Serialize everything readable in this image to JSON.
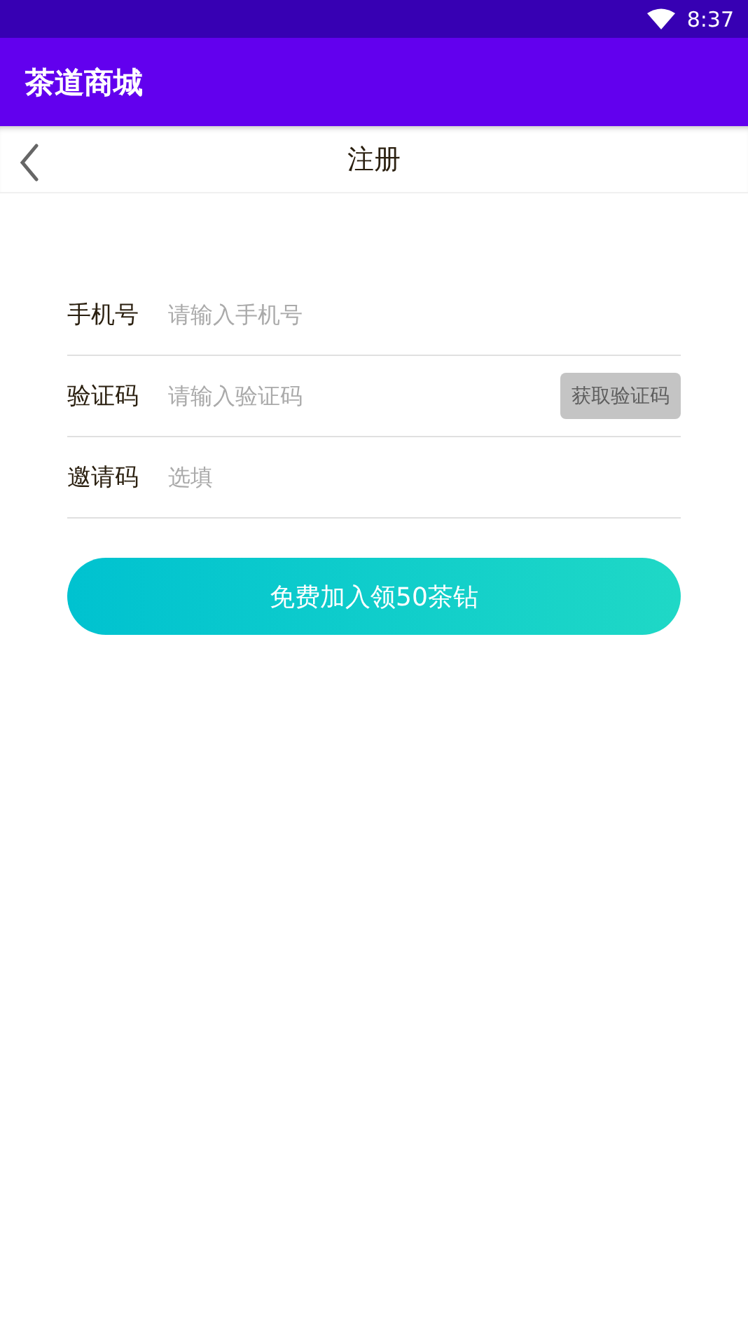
{
  "status_bar": {
    "time": "8:37"
  },
  "app_bar": {
    "title": "茶道商城"
  },
  "header": {
    "title": "注册"
  },
  "fields": [
    {
      "kind": "plain",
      "label": "手机号",
      "placeholder": "请输入手机号"
    },
    {
      "kind": "code",
      "label": "验证码",
      "placeholder": "请输入验证码",
      "button": {
        "label": "获取验证码",
        "disabled": true
      }
    },
    {
      "kind": "plain",
      "label": "邀请码",
      "placeholder": "选填"
    }
  ],
  "submit": {
    "label": "免费加入领50茶钻"
  }
}
